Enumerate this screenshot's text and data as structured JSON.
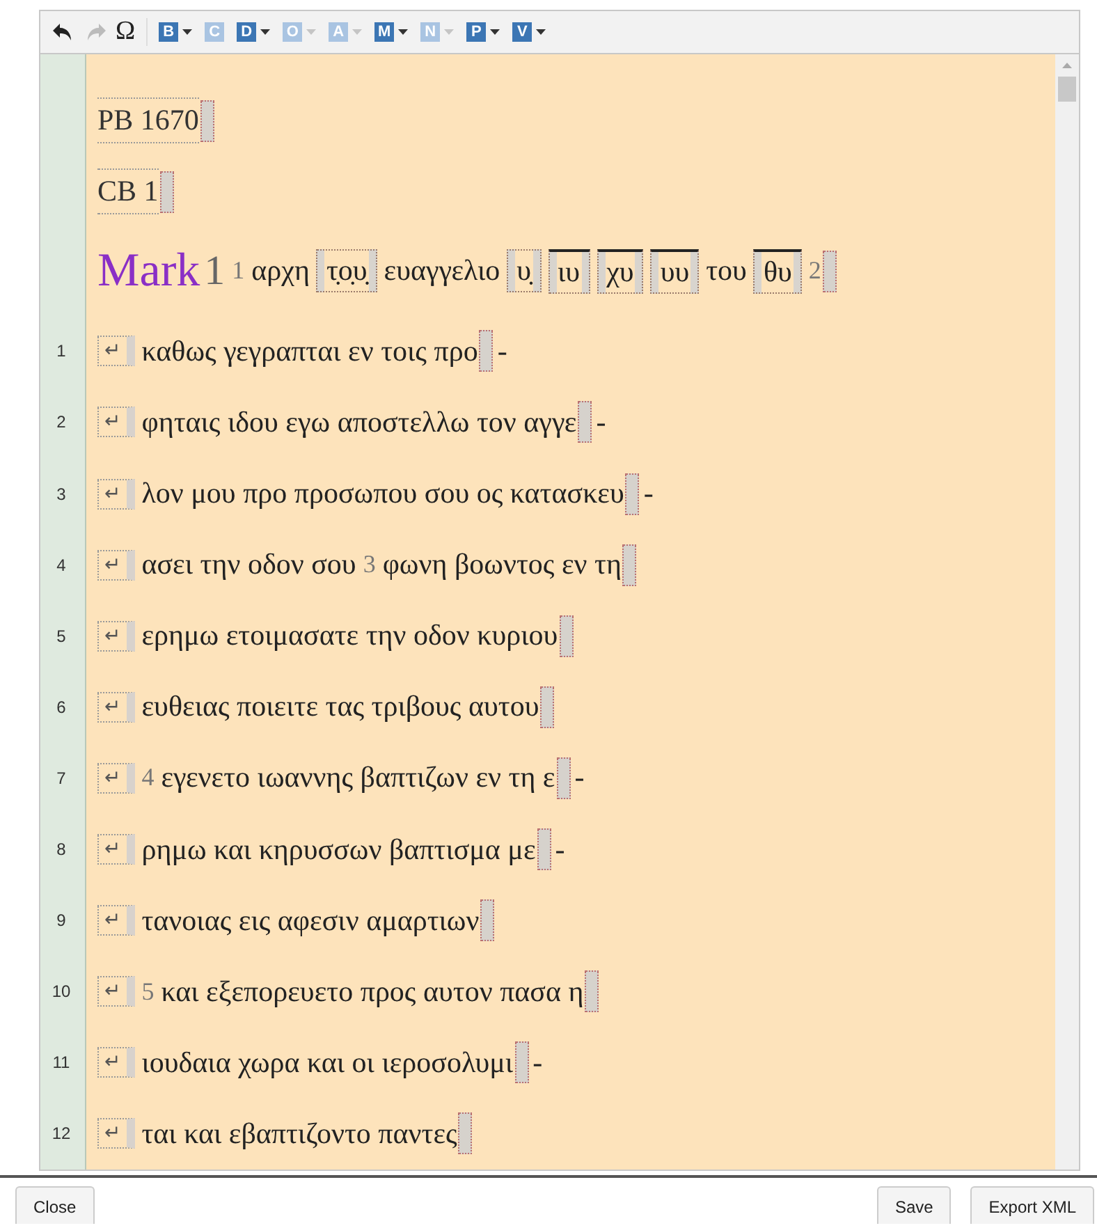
{
  "toolbar": [
    {
      "kind": "undo",
      "enabled": true
    },
    {
      "kind": "redo",
      "enabled": false
    },
    {
      "kind": "symbol",
      "label": "Ω"
    },
    {
      "kind": "tag",
      "label": "B",
      "enabled": true,
      "dropdown": true
    },
    {
      "kind": "tag",
      "label": "C",
      "enabled": false,
      "dropdown": false
    },
    {
      "kind": "tag",
      "label": "D",
      "enabled": true,
      "dropdown": true
    },
    {
      "kind": "tag",
      "label": "O",
      "enabled": false,
      "dropdown": true
    },
    {
      "kind": "tag",
      "label": "A",
      "enabled": false,
      "dropdown": true
    },
    {
      "kind": "tag",
      "label": "M",
      "enabled": true,
      "dropdown": true
    },
    {
      "kind": "tag",
      "label": "N",
      "enabled": false,
      "dropdown": true
    },
    {
      "kind": "tag",
      "label": "P",
      "enabled": true,
      "dropdown": true
    },
    {
      "kind": "tag",
      "label": "V",
      "enabled": true,
      "dropdown": true
    }
  ],
  "blocks": [
    {
      "kind": "milestone",
      "text": "PB 1670"
    },
    {
      "kind": "milestone",
      "text": "CB 1"
    },
    {
      "kind": "heading",
      "book": "Mark",
      "chapter": "1",
      "segments": [
        {
          "kind": "verse",
          "text": "1"
        },
        {
          "kind": "text",
          "text": "αρχη"
        },
        {
          "kind": "abbr",
          "text": "τ̣ο̣υ̣",
          "overline": false
        },
        {
          "kind": "text",
          "text": "ευαγγελιο"
        },
        {
          "kind": "abbr",
          "text": "υ̣",
          "overline": false
        },
        {
          "kind": "abbr",
          "text": "ιυ",
          "overline": true
        },
        {
          "kind": "abbr",
          "text": "χυ",
          "overline": true
        },
        {
          "kind": "abbr",
          "text": "υυ",
          "overline": true
        },
        {
          "kind": "text",
          "text": "του"
        },
        {
          "kind": "abbr",
          "text": "θυ",
          "overline": true
        },
        {
          "kind": "verse",
          "text": "2"
        }
      ]
    }
  ],
  "lines": [
    {
      "number": "1",
      "break": "↵",
      "segments": [
        {
          "kind": "text",
          "text": "καθως γεγραπται εν τοις προ"
        }
      ],
      "hyphen": "-"
    },
    {
      "number": "2",
      "break": "↵",
      "segments": [
        {
          "kind": "text",
          "text": "φηταις ιδου εγω αποστελλω τον αγγε"
        }
      ],
      "hyphen": "-"
    },
    {
      "number": "3",
      "break": "↵",
      "segments": [
        {
          "kind": "text",
          "text": "λον μου προ προσωπου σου ος κατασκευ"
        }
      ],
      "hyphen": "-"
    },
    {
      "number": "4",
      "break": "↵",
      "segments": [
        {
          "kind": "text",
          "text": "ασει την οδον σου"
        },
        {
          "kind": "verse",
          "text": "3"
        },
        {
          "kind": "text",
          "text": "φωνη βοωντος εν τη"
        }
      ]
    },
    {
      "number": "5",
      "break": "↵",
      "segments": [
        {
          "kind": "text",
          "text": "ερημω ετοιμασατε την οδον κυριου"
        }
      ]
    },
    {
      "number": "6",
      "break": "↵",
      "segments": [
        {
          "kind": "text",
          "text": "ευθειας ποιειτε τας τριβους αυτου"
        }
      ]
    },
    {
      "number": "7",
      "break": "↵",
      "segments": [
        {
          "kind": "verse",
          "text": "4"
        },
        {
          "kind": "text",
          "text": "εγενετο ιωαννης βαπτιζων εν τη ε"
        }
      ],
      "hyphen": "-"
    },
    {
      "number": "8",
      "break": "↵",
      "segments": [
        {
          "kind": "text",
          "text": "ρημω και κηρυσσων βαπτισμα με"
        }
      ],
      "hyphen": "-"
    },
    {
      "number": "9",
      "break": "↵",
      "segments": [
        {
          "kind": "text",
          "text": "τανοιας εις αφεσιν αμαρτιων"
        }
      ]
    },
    {
      "number": "10",
      "break": "↵",
      "segments": [
        {
          "kind": "verse",
          "text": "5"
        },
        {
          "kind": "text",
          "text": "και εξεπορευετο προς αυτον πασα η"
        }
      ]
    },
    {
      "number": "11",
      "break": "↵",
      "segments": [
        {
          "kind": "text",
          "text": "ιουδαια χωρα και οι ιεροσολυμι"
        }
      ],
      "hyphen": "-"
    },
    {
      "number": "12",
      "break": "↵",
      "segments": [
        {
          "kind": "text",
          "text": "ται και εβαπτιζοντο παντες"
        }
      ]
    }
  ],
  "footer": {
    "left": [
      "Close"
    ],
    "right": [
      "Save",
      "Export XML"
    ]
  }
}
